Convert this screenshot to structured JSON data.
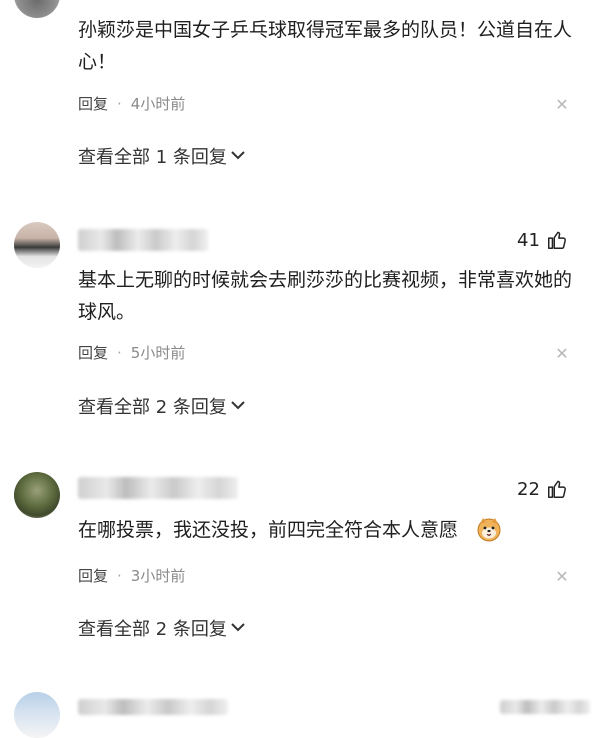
{
  "comments": [
    {
      "text": "孙颖莎是中国女子乒乓球取得冠军最多的队员！公道自在人心！",
      "reply_label": "回复",
      "time": "4小时前",
      "view_all": "查看全部 1 条回复"
    },
    {
      "likes": "41",
      "text": "基本上无聊的时候就会去刷莎莎的比赛视频，非常喜欢她的球风。",
      "reply_label": "回复",
      "time": "5小时前",
      "view_all": "查看全部 2 条回复"
    },
    {
      "likes": "22",
      "text": "在哪投票，我还没投，前四完全符合本人意愿",
      "reply_label": "回复",
      "time": "3小时前",
      "view_all": "查看全部 2 条回复"
    }
  ],
  "separator": "·",
  "icons": {
    "close": "close-icon",
    "like": "thumbs-up-icon",
    "chevron": "chevron-down-icon",
    "emoji": "shiba-dog-emoji-icon"
  }
}
